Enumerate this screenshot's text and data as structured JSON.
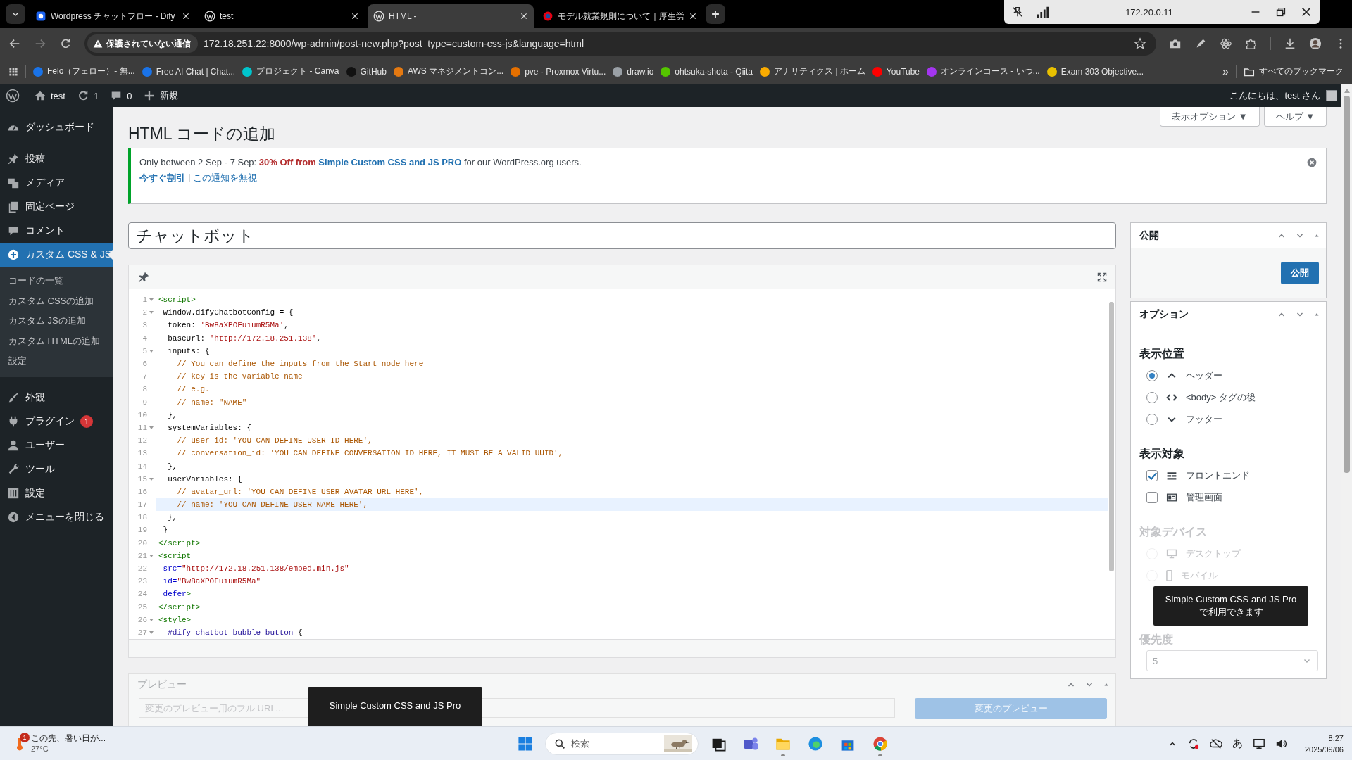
{
  "browser": {
    "tabs": [
      {
        "title": "Wordpress チャットフロー - Dify",
        "selected": false
      },
      {
        "title": "test",
        "selected": false
      },
      {
        "title": "HTML -",
        "selected": true
      },
      {
        "title": "モデル就業規則について｜厚生労",
        "selected": false
      }
    ],
    "remote_host": "172.20.0.11",
    "security_label": "保護されていない通信",
    "url": "172.18.251.22:8000/wp-admin/post-new.php?post_type=custom-css-js&language=html",
    "bookmarks": [
      {
        "label": "Felo（フェロー）- 無...",
        "color": "#1a73e8"
      },
      {
        "label": "Free AI Chat | Chat...",
        "color": "#1a73e8"
      },
      {
        "label": "プロジェクト - Canva",
        "color": "#00c4cc"
      },
      {
        "label": "GitHub",
        "color": "#111111"
      },
      {
        "label": "AWS マネジメントコン...",
        "color": "#e47911"
      },
      {
        "label": "pve - Proxmox Virtu...",
        "color": "#e57000"
      },
      {
        "label": "draw.io",
        "color": "#9aa0a6"
      },
      {
        "label": "ohtsuka-shota - Qiita",
        "color": "#55c500"
      },
      {
        "label": "アナリティクス | ホーム",
        "color": "#f9ab00"
      },
      {
        "label": "YouTube",
        "color": "#ff0000"
      },
      {
        "label": "オンラインコース - いつ...",
        "color": "#a435f0"
      },
      {
        "label": "Exam 303 Objective...",
        "color": "#e8c000"
      }
    ],
    "more": "»",
    "all_bookmarks": "すべてのブックマーク"
  },
  "admin_bar": {
    "site": "test",
    "updates": "1",
    "comments": "0",
    "new": "新規",
    "greeting": "こんにちは、test さん"
  },
  "sidebar": {
    "items": [
      {
        "label": "ダッシュボード",
        "selected": false
      },
      {
        "label": "投稿",
        "selected": false
      },
      {
        "label": "メディア",
        "selected": false
      },
      {
        "label": "固定ページ",
        "selected": false
      },
      {
        "label": "コメント",
        "selected": false
      },
      {
        "label": "カスタム CSS & JS",
        "selected": true,
        "children": [
          {
            "label": "コードの一覧"
          },
          {
            "label": "カスタム CSSの追加"
          },
          {
            "label": "カスタム JSの追加"
          },
          {
            "label": "カスタム HTMLの追加"
          },
          {
            "label": "設定"
          }
        ]
      },
      {
        "label": "外観",
        "selected": false
      },
      {
        "label": "プラグイン",
        "selected": false,
        "badge": "1"
      },
      {
        "label": "ユーザー",
        "selected": false
      },
      {
        "label": "ツール",
        "selected": false
      },
      {
        "label": "設定",
        "selected": false
      },
      {
        "label": "メニューを閉じる",
        "selected": false
      }
    ]
  },
  "screen_options": "表示オプション ▼",
  "help": "ヘルプ ▼",
  "page_title": "HTML コードの追加",
  "notice": {
    "prefix": "Only between 2 Sep - 7 Sep: ",
    "highlight": "30% Off from",
    "link": "Simple Custom CSS and JS PRO",
    "suffix": " for our WordPress.org users.",
    "actions": [
      {
        "label": "今すぐ割引",
        "strong": true
      },
      {
        "label": "この通知を無視",
        "strong": false
      }
    ],
    "separator": "|"
  },
  "post_title": "チャットボット",
  "code_lines": [
    {
      "n": "1",
      "fold": true,
      "active": false,
      "tokens": [
        {
          "kind": "tag",
          "text": "<script>"
        }
      ]
    },
    {
      "n": "2",
      "fold": true,
      "active": false,
      "tokens": [
        {
          "kind": "plain",
          "text": " window.difyChatbotConfig = {"
        }
      ]
    },
    {
      "n": "3",
      "fold": false,
      "active": false,
      "tokens": [
        {
          "kind": "plain",
          "text": "  token: "
        },
        {
          "kind": "str",
          "text": "'Bw8aXPOFuiumR5Ma'"
        },
        {
          "kind": "plain",
          "text": ","
        }
      ]
    },
    {
      "n": "4",
      "fold": false,
      "active": false,
      "tokens": [
        {
          "kind": "plain",
          "text": "  baseUrl: "
        },
        {
          "kind": "str",
          "text": "'http://172.18.251.138'"
        },
        {
          "kind": "plain",
          "text": ","
        }
      ]
    },
    {
      "n": "5",
      "fold": true,
      "active": false,
      "tokens": [
        {
          "kind": "plain",
          "text": "  inputs: {"
        }
      ]
    },
    {
      "n": "6",
      "fold": false,
      "active": false,
      "tokens": [
        {
          "kind": "com",
          "text": "    // You can define the inputs from the Start node here"
        }
      ]
    },
    {
      "n": "7",
      "fold": false,
      "active": false,
      "tokens": [
        {
          "kind": "com",
          "text": "    // key is the variable name"
        }
      ]
    },
    {
      "n": "8",
      "fold": false,
      "active": false,
      "tokens": [
        {
          "kind": "com",
          "text": "    // e.g."
        }
      ]
    },
    {
      "n": "9",
      "fold": false,
      "active": false,
      "tokens": [
        {
          "kind": "com",
          "text": "    // name: \"NAME\""
        }
      ]
    },
    {
      "n": "10",
      "fold": false,
      "active": false,
      "tokens": [
        {
          "kind": "plain",
          "text": "  },"
        }
      ]
    },
    {
      "n": "11",
      "fold": true,
      "active": false,
      "tokens": [
        {
          "kind": "plain",
          "text": "  systemVariables: {"
        }
      ]
    },
    {
      "n": "12",
      "fold": false,
      "active": false,
      "tokens": [
        {
          "kind": "com",
          "text": "    // user_id: 'YOU CAN DEFINE USER ID HERE',"
        }
      ]
    },
    {
      "n": "13",
      "fold": false,
      "active": false,
      "tokens": [
        {
          "kind": "com",
          "text": "    // conversation_id: 'YOU CAN DEFINE CONVERSATION ID HERE, IT MUST BE A VALID UUID',"
        }
      ]
    },
    {
      "n": "14",
      "fold": false,
      "active": false,
      "tokens": [
        {
          "kind": "plain",
          "text": "  },"
        }
      ]
    },
    {
      "n": "15",
      "fold": true,
      "active": false,
      "tokens": [
        {
          "kind": "plain",
          "text": "  userVariables: {"
        }
      ]
    },
    {
      "n": "16",
      "fold": false,
      "active": false,
      "tokens": [
        {
          "kind": "com",
          "text": "    // avatar_url: 'YOU CAN DEFINE USER AVATAR URL HERE',"
        }
      ]
    },
    {
      "n": "17",
      "fold": false,
      "active": true,
      "tokens": [
        {
          "kind": "com",
          "text": "    // name: 'YOU CAN DEFINE USER NAME HERE',"
        }
      ]
    },
    {
      "n": "18",
      "fold": false,
      "active": false,
      "tokens": [
        {
          "kind": "plain",
          "text": "  },"
        }
      ]
    },
    {
      "n": "19",
      "fold": false,
      "active": false,
      "tokens": [
        {
          "kind": "plain",
          "text": " }"
        }
      ]
    },
    {
      "n": "20",
      "fold": false,
      "active": false,
      "tokens": [
        {
          "kind": "tag",
          "text": "</script>"
        }
      ]
    },
    {
      "n": "21",
      "fold": true,
      "active": false,
      "tokens": [
        {
          "kind": "tag",
          "text": "<script"
        }
      ]
    },
    {
      "n": "22",
      "fold": false,
      "active": false,
      "tokens": [
        {
          "kind": "attr",
          "text": " src="
        },
        {
          "kind": "str",
          "text": "\"http://172.18.251.138/embed.min.js\""
        }
      ]
    },
    {
      "n": "23",
      "fold": false,
      "active": false,
      "tokens": [
        {
          "kind": "attr",
          "text": " id="
        },
        {
          "kind": "str",
          "text": "\"Bw8aXPOFuiumR5Ma\""
        }
      ]
    },
    {
      "n": "24",
      "fold": false,
      "active": false,
      "tokens": [
        {
          "kind": "attr",
          "text": " defer"
        },
        {
          "kind": "tag",
          "text": ">"
        }
      ]
    },
    {
      "n": "25",
      "fold": false,
      "active": false,
      "tokens": [
        {
          "kind": "tag",
          "text": "</script>"
        }
      ]
    },
    {
      "n": "26",
      "fold": true,
      "active": false,
      "tokens": [
        {
          "kind": "tag",
          "text": "<style>"
        }
      ]
    },
    {
      "n": "27",
      "fold": true,
      "active": false,
      "tokens": [
        {
          "kind": "sel",
          "text": "  #dify-chatbot-bubble-button"
        },
        {
          "kind": "plain",
          "text": " {"
        }
      ]
    }
  ],
  "preview": {
    "title": "プレビュー",
    "placeholder": "変更のプレビュー用のフル URL...",
    "button": "変更のプレビュー",
    "button_disabled": true,
    "tooltip": "Simple Custom CSS and JS Pro"
  },
  "publish_box": {
    "title": "公開",
    "button": "公開"
  },
  "options_box": {
    "title": "オプション",
    "sections": [
      {
        "heading": "表示位置",
        "kind": "radio",
        "disabled": false,
        "items": [
          {
            "label": "ヘッダー",
            "selected": true
          },
          {
            "label": "<body> タグの後",
            "selected": false
          },
          {
            "label": "フッター",
            "selected": false
          }
        ]
      },
      {
        "heading": "表示対象",
        "kind": "checkbox",
        "disabled": false,
        "items": [
          {
            "label": "フロントエンド",
            "checked": true
          },
          {
            "label": "管理画面",
            "checked": false
          }
        ]
      },
      {
        "heading": "対象デバイス",
        "kind": "radio",
        "disabled": true,
        "items": [
          {
            "label": "デスクトップ",
            "selected": false
          },
          {
            "label": "モバイル",
            "selected": false
          }
        ]
      }
    ],
    "tooltip": "Simple Custom CSS and JS Pro\nで利用できます",
    "priority": {
      "heading": "優先度",
      "value": "5",
      "disabled": true
    }
  },
  "taskbar": {
    "weather": {
      "text": "この先、暑い日が...",
      "temp": "27°C",
      "badge": "1"
    },
    "search": "検索",
    "apps": [
      {
        "running": false
      },
      {
        "running": false
      },
      {
        "running": true
      },
      {
        "running": false
      },
      {
        "running": false
      },
      {
        "running": true
      }
    ],
    "ime": "あ",
    "time": "8:27",
    "date": "2025/09/06"
  }
}
